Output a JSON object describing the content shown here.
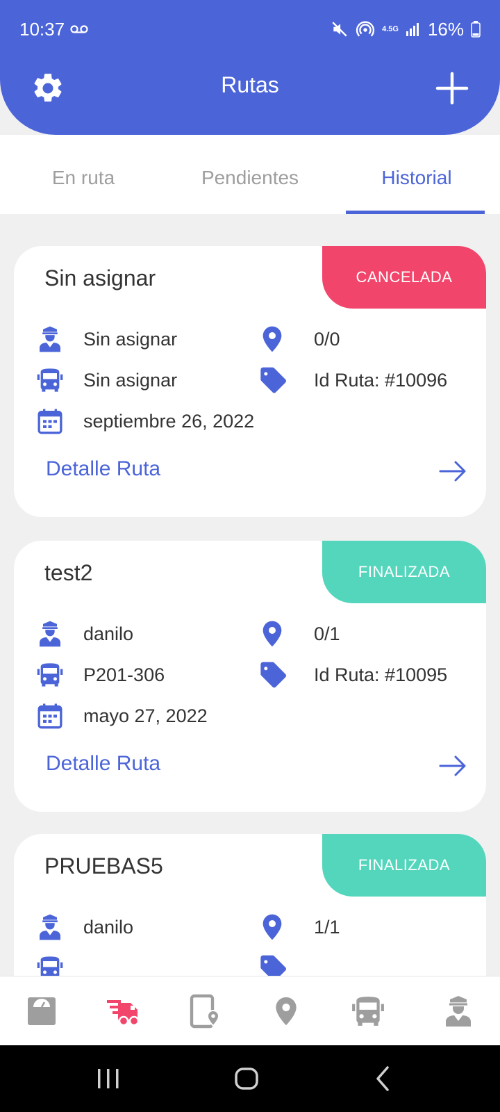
{
  "status_bar": {
    "time": "10:37",
    "network": "4.5G",
    "battery": "16%"
  },
  "app_bar": {
    "title": "Rutas",
    "settings_icon": "gear-icon",
    "add_icon": "plus-icon"
  },
  "tabs": [
    {
      "label": "En ruta",
      "active": false
    },
    {
      "label": "Pendientes",
      "active": false
    },
    {
      "label": "Historial",
      "active": true
    }
  ],
  "routes": [
    {
      "title": "Sin asignar",
      "status": "CANCELADA",
      "status_color": "#f2456b",
      "driver": "Sin asignar",
      "stops": "0/0",
      "vehicle": "Sin asignar",
      "route_id": "Id Ruta: #10096",
      "date": "septiembre 26, 2022",
      "link": "Detalle Ruta"
    },
    {
      "title": "test2",
      "status": "FINALIZADA",
      "status_color": "#53d6bc",
      "driver": "danilo",
      "stops": "0/1",
      "vehicle": "P201-306",
      "route_id": "Id Ruta: #10095",
      "date": "mayo 27, 2022",
      "link": "Detalle Ruta"
    },
    {
      "title": "PRUEBAS5",
      "status": "FINALIZADA",
      "status_color": "#53d6bc",
      "driver": "danilo",
      "stops": "1/1",
      "vehicle": "",
      "route_id": "",
      "date": "",
      "link": ""
    }
  ],
  "bottom_nav": [
    {
      "icon": "scale-icon",
      "active": false
    },
    {
      "icon": "delivery-truck-icon",
      "active": true
    },
    {
      "icon": "tablet-location-icon",
      "active": false
    },
    {
      "icon": "location-pin-icon",
      "active": false
    },
    {
      "icon": "bus-icon",
      "active": false
    },
    {
      "icon": "driver-icon",
      "active": false
    }
  ],
  "colors": {
    "primary": "#4b64d8",
    "cancel": "#f2456b",
    "done": "#53d6bc",
    "active_nav": "#f2456b",
    "inactive_nav": "#9e9e9e"
  }
}
